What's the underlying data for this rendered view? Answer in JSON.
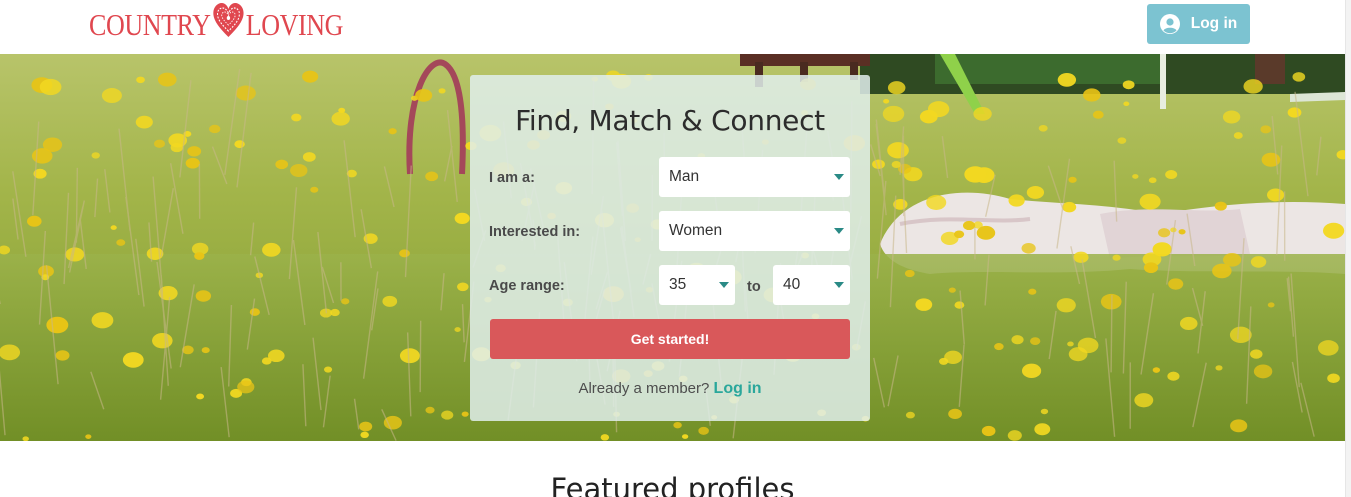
{
  "brand": {
    "logo_left": "COUNTRY",
    "logo_right": "LOVING",
    "color": "#e0474f"
  },
  "header": {
    "login_label": "Log in",
    "login_icon": "user-icon",
    "login_color": "#7cc3d1"
  },
  "form": {
    "title": "Find, Match & Connect",
    "i_am_label": "I am a:",
    "i_am_value": "Man",
    "interested_label": "Interested in:",
    "interested_value": "Women",
    "age_label": "Age range:",
    "age_from": "35",
    "age_to_label": "to",
    "age_to": "40",
    "submit_label": "Get started!",
    "submit_color": "#d9585a",
    "member_text": "Already a member?",
    "member_link": "Log in",
    "link_color": "#2aa79b"
  },
  "featured": {
    "heading": "Featured profiles"
  }
}
